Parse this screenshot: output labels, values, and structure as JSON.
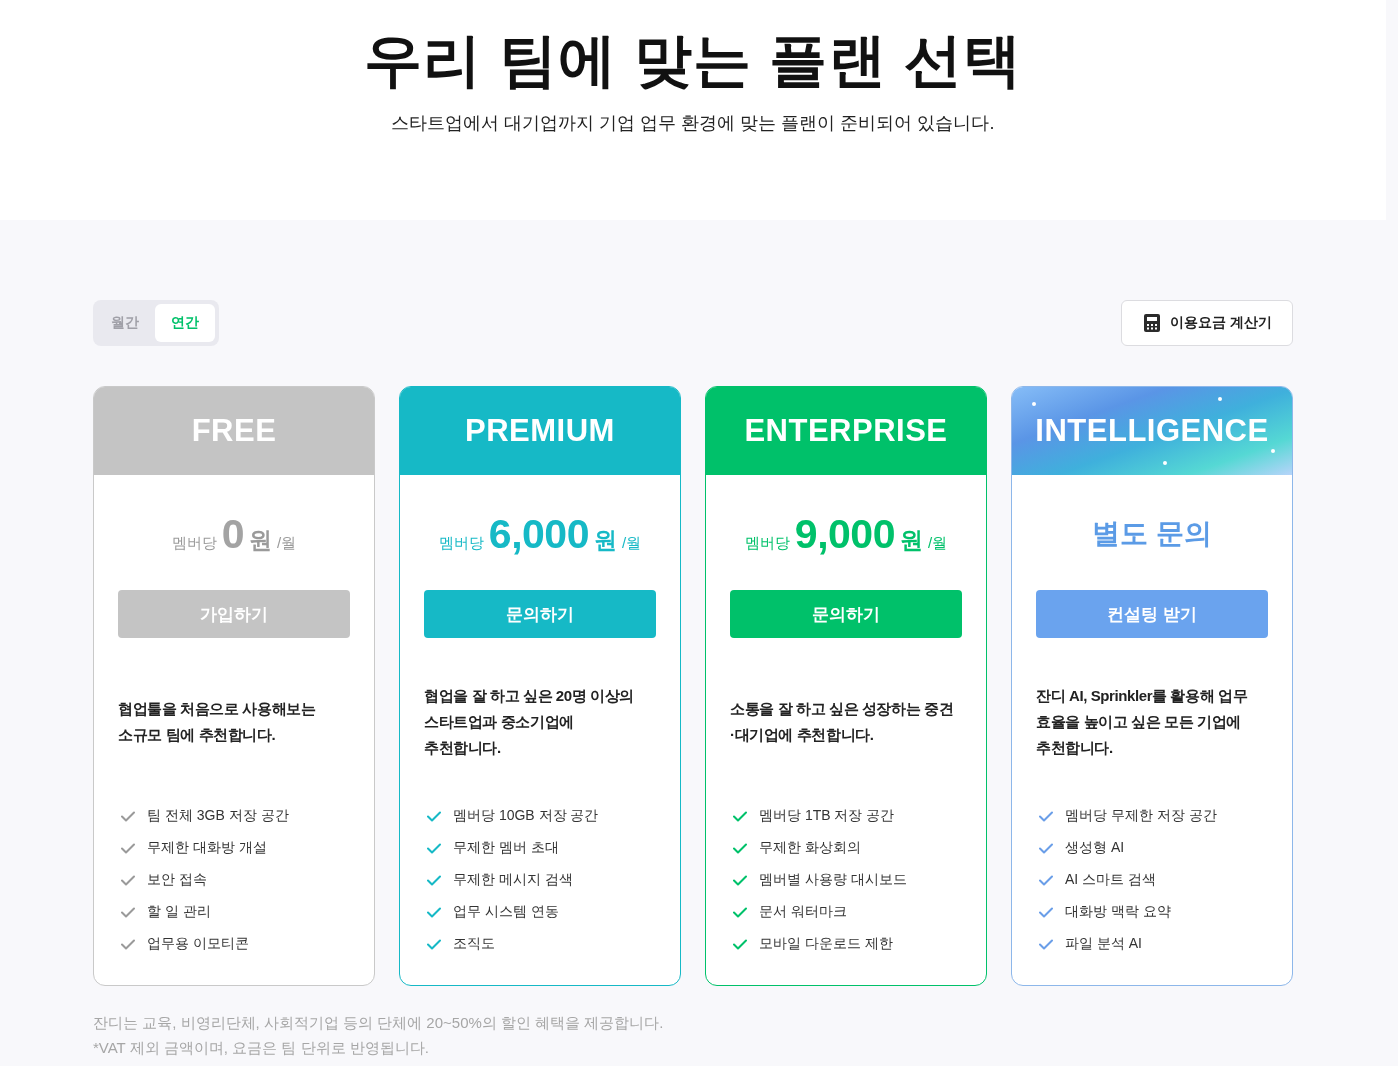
{
  "header": {
    "title": "우리 팀에 맞는 플랜 선택",
    "subtitle": "스타트업에서 대기업까지 기업 업무 환경에 맞는 플랜이 준비되어 있습니다."
  },
  "billing_toggle": [
    {
      "label": "월간",
      "selected": false
    },
    {
      "label": "연간",
      "selected": true
    }
  ],
  "calculator_button": {
    "label": "이용요금 계산기"
  },
  "plans": [
    {
      "kind": "free",
      "name": "FREE",
      "color": "#c4c4c4",
      "price": {
        "kind": "amount",
        "prefix": "멤버당",
        "amount": "0",
        "unit": "원",
        "period": "/월"
      },
      "button": "가입하기",
      "description_lines": [
        "협업툴을 처음으로 사용해보는",
        "소규모 팀에 추천합니다."
      ],
      "features": [
        "팀 전체 3GB 저장 공간",
        "무제한 대화방 개설",
        "보안 접속",
        "할 일 관리",
        "업무용 이모티콘"
      ]
    },
    {
      "kind": "premium",
      "name": "PREMIUM",
      "color": "#16b9c6",
      "price": {
        "kind": "amount",
        "prefix": "멤버당",
        "amount": "6,000",
        "unit": "원",
        "period": "/월"
      },
      "button": "문의하기",
      "description_lines": [
        "협업을 잘 하고 싶은 20명 이상의",
        "스타트업과 중소기업에",
        "추천합니다."
      ],
      "features": [
        "멤버당 10GB 저장 공간",
        "무제한 멤버 초대",
        "무제한 메시지 검색",
        "업무 시스템 연동",
        "조직도"
      ]
    },
    {
      "kind": "enterprise",
      "name": "ENTERPRISE",
      "color": "#00c16a",
      "price": {
        "kind": "amount",
        "prefix": "멤버당",
        "amount": "9,000",
        "unit": "원",
        "period": "/월"
      },
      "button": "문의하기",
      "description_lines": [
        "소통을 잘 하고 싶은 성장하는 중견",
        "·대기업에 추천합니다."
      ],
      "features": [
        "멤버당 1TB 저장 공간",
        "무제한 화상회의",
        "멤버별 사용량 대시보드",
        "문서 워터마크",
        "모바일 다운로드 제한"
      ]
    },
    {
      "kind": "intelligence",
      "name": "INTELLIGENCE",
      "color": "#6aa3ee",
      "price": {
        "kind": "inquiry",
        "text": "별도 문의"
      },
      "button": "컨설팅 받기",
      "description_lines": [
        "잔디 AI, Sprinkler를 활용해 업무",
        "효율을 높이고 싶은 모든 기업에",
        "추천합니다."
      ],
      "features": [
        "멤버당 무제한 저장 공간",
        "생성형 AI",
        "AI 스마트 검색",
        "대화방 맥락 요약",
        "파일 분석 AI"
      ]
    }
  ],
  "footnotes": [
    "잔디는 교육, 비영리단체, 사회적기업 등의 단체에 20~50%의 할인 혜택을 제공합니다.",
    "*VAT 제외 금액이며, 요금은 팀 단위로 반영됩니다."
  ]
}
